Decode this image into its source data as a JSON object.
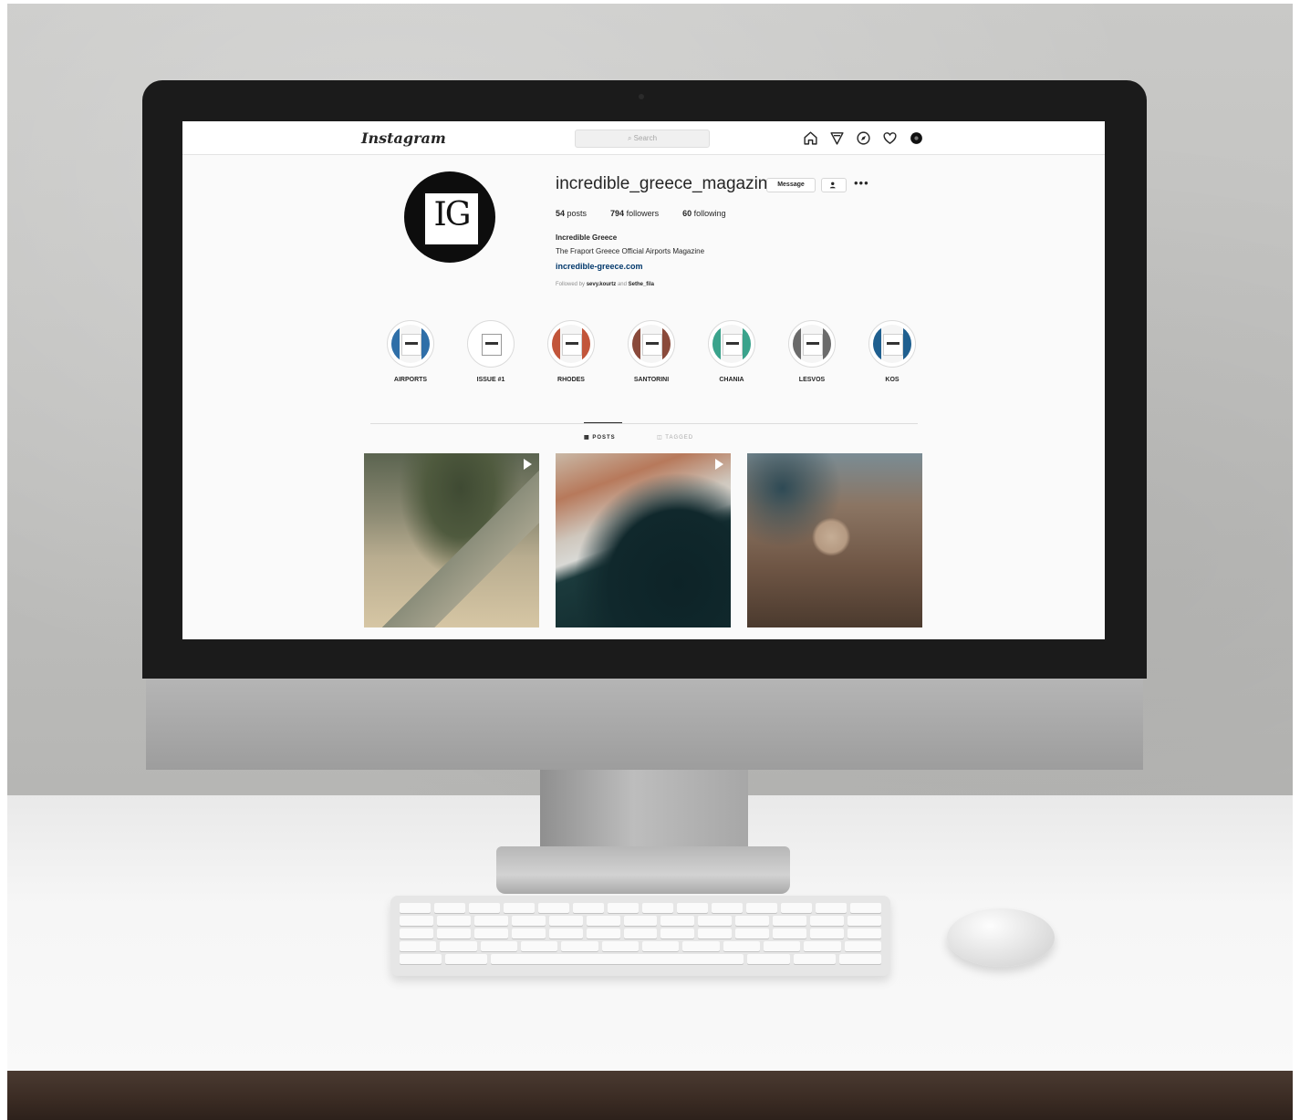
{
  "app": {
    "logo_text": "Instagram",
    "search_placeholder": "Search"
  },
  "nav_icons": [
    "home-icon",
    "direct-icon",
    "explore-icon",
    "activity-icon",
    "profile-icon"
  ],
  "profile": {
    "avatar_text": "IG",
    "username": "incredible_greece_magazine",
    "message_label": "Message",
    "follow_icon": "user-check-icon",
    "more_label": "•••",
    "stats": {
      "posts_count": "54",
      "posts_label": "posts",
      "followers_count": "794",
      "followers_label": "followers",
      "following_count": "60",
      "following_label": "following"
    },
    "bio_name": "Incredible Greece",
    "bio_line": "The Fraport Greece Official Airports Magazine",
    "bio_link": "incredible-greece.com",
    "followed_by_prefix": "Followed by",
    "followed_by_user1": "sevy.kourtz",
    "followed_by_and": "and",
    "followed_by_user2": "Sethe_fila"
  },
  "highlights": [
    {
      "label": "AIRPORTS",
      "color": "#2f6fa8"
    },
    {
      "label": "ISSUE #1",
      "color": "#ffffff"
    },
    {
      "label": "RHODES",
      "color": "#c2553a"
    },
    {
      "label": "SANTORINI",
      "color": "#8a4a3b"
    },
    {
      "label": "CHANIA",
      "color": "#3aa38c"
    },
    {
      "label": "LESVOS",
      "color": "#6b6b6b"
    },
    {
      "label": "KOS",
      "color": "#1f5f8f"
    }
  ],
  "tabs": {
    "posts_label": "POSTS",
    "tagged_label": "TAGGED"
  },
  "posts": [
    {
      "kind": "video"
    },
    {
      "kind": "video"
    },
    {
      "kind": "photo"
    }
  ]
}
